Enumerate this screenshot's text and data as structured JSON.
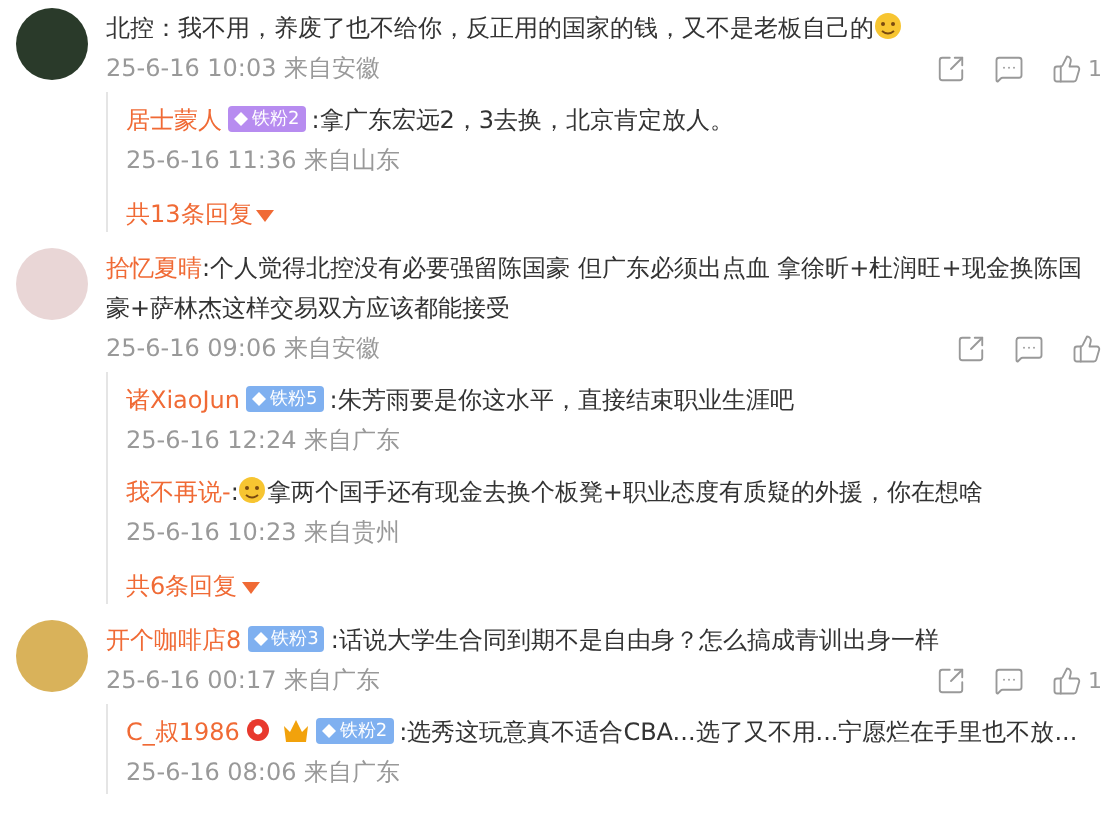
{
  "comments": [
    {
      "parts": [
        {
          "kind": "text",
          "text": "北控：我不用，养废了也不给你，反正用的国家的钱，又不是老板自己的"
        },
        {
          "kind": "emoji"
        }
      ],
      "meta": "25-6-16 10:03 来自安徽",
      "likes": "1",
      "replies": [
        {
          "author": "居士蒙人",
          "badge": {
            "label": "铁粉2",
            "color": "#b78cf0"
          },
          "parts": [
            {
              "kind": "text",
              "text": ":拿广东宏远2，3去换，北京肯定放人。"
            }
          ],
          "meta": "25-6-16 11:36 来自山东"
        }
      ],
      "more": "共13条回复"
    },
    {
      "author": "拾忆夏晴",
      "parts": [
        {
          "kind": "text",
          "text": ":个人觉得北控没有必要强留陈国豪 但广东必须出点血 拿徐昕+杜润旺+现金换陈国豪+萨林杰这样交易双方应该都能接受"
        }
      ],
      "meta": "25-6-16 09:06 来自安徽",
      "replies": [
        {
          "author": "诸XiaoJun",
          "badge": {
            "label": "铁粉5",
            "color": "#7fb0f0"
          },
          "parts": [
            {
              "kind": "text",
              "text": ":朱芳雨要是你这水平，直接结束职业生涯吧"
            }
          ],
          "meta": "25-6-16 12:24 来自广东"
        },
        {
          "author": "我不再说-",
          "parts": [
            {
              "kind": "text",
              "text": ":"
            },
            {
              "kind": "emoji"
            },
            {
              "kind": "text",
              "text": "拿两个国手还有现金去换个板凳+职业态度有质疑的外援，你在想啥"
            }
          ],
          "meta": "25-6-16 10:23 来自贵州"
        }
      ],
      "more": "共6条回复"
    },
    {
      "author": "开个咖啡店8",
      "badge": {
        "label": "铁粉3",
        "color": "#7fb0f0"
      },
      "parts": [
        {
          "kind": "text",
          "text": ":话说大学生合同到期不是自由身？怎么搞成青训出身一样"
        }
      ],
      "meta": "25-6-16 00:17 来自广东",
      "likes": "1",
      "replies": [
        {
          "author": "C_叔1986",
          "badge": {
            "label": "铁粉2",
            "color": "#7fb0f0"
          },
          "verified": true,
          "crowned": true,
          "parts": [
            {
              "kind": "text",
              "text": ":选秀这玩意真不适合CBA...选了又不用...宁愿烂在手里也不放..."
            }
          ],
          "meta": "25-6-16 08:06 来自广东"
        }
      ]
    }
  ]
}
